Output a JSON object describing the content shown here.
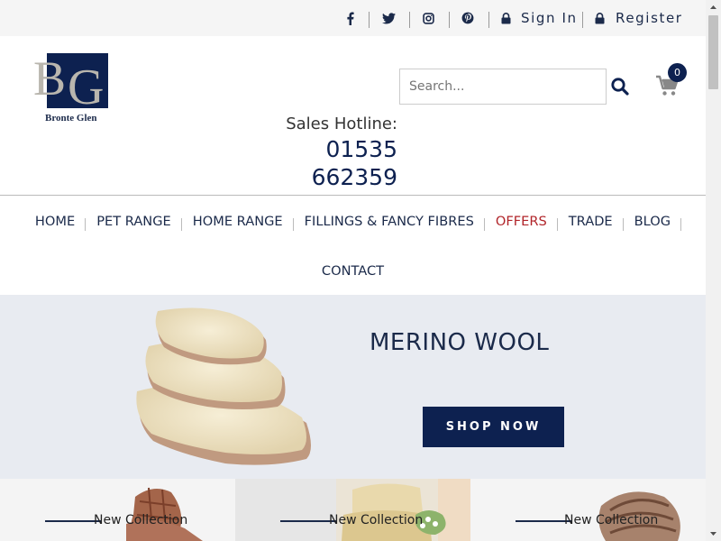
{
  "topbar": {
    "social": [
      "facebook-icon",
      "twitter-icon",
      "instagram-icon",
      "pinterest-icon"
    ],
    "sign_in": "Sign In",
    "register": "Register"
  },
  "header": {
    "logo_text": "Bronte Glen",
    "logo_letters": "BG",
    "hotline_label": "Sales Hotline:",
    "hotline_number_line1": "01535",
    "hotline_number_line2": "662359",
    "search_placeholder": "Search...",
    "cart_count": "0"
  },
  "nav": {
    "items": [
      "HOME",
      "PET RANGE",
      "HOME RANGE",
      "FILLINGS & FANCY FIBRES",
      "OFFERS",
      "TRADE",
      "BLOG"
    ],
    "second_row": "CONTACT"
  },
  "banner": {
    "title": "MERINO WOOL",
    "button": "SHOP NOW"
  },
  "collections": [
    {
      "label": "New Collection"
    },
    {
      "label": "New Collection"
    },
    {
      "label": "New Collection"
    }
  ],
  "colors": {
    "navy": "#0d2150",
    "offer_red": "#b1252a",
    "banner_bg": "#e8ebf1"
  }
}
